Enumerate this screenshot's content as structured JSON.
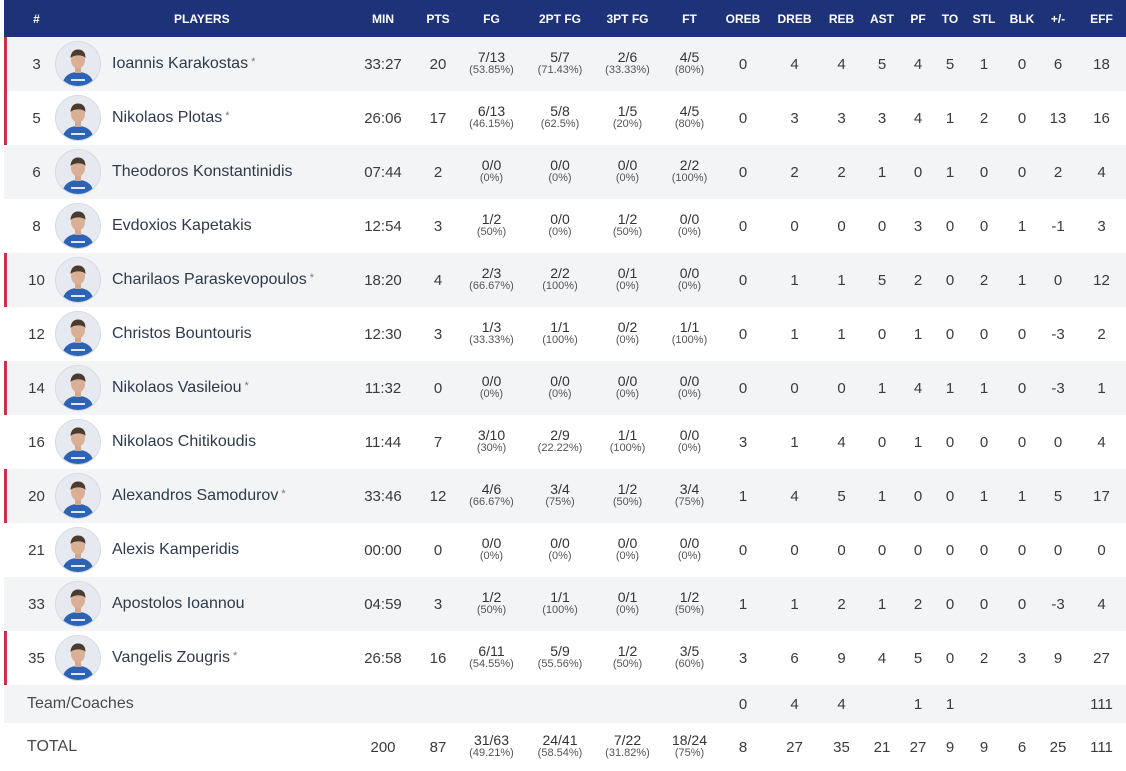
{
  "columns": [
    "#",
    "PLAYERS",
    "MIN",
    "PTS",
    "FG",
    "2PT FG",
    "3PT FG",
    "FT",
    "OREB",
    "DREB",
    "REB",
    "AST",
    "PF",
    "TO",
    "STL",
    "BLK",
    "+/-",
    "EFF"
  ],
  "starter_marker": "*",
  "players": [
    {
      "num": "3",
      "name": "Ioannis Karakostas",
      "starter": true,
      "min": "33:27",
      "pts": "20",
      "fg": {
        "made": "7/13",
        "pct": "(53.85%)"
      },
      "fg2": {
        "made": "5/7",
        "pct": "(71.43%)"
      },
      "fg3": {
        "made": "2/6",
        "pct": "(33.33%)"
      },
      "ft": {
        "made": "4/5",
        "pct": "(80%)"
      },
      "oreb": "0",
      "dreb": "4",
      "reb": "4",
      "ast": "5",
      "pf": "4",
      "to": "5",
      "stl": "1",
      "blk": "0",
      "pm": "6",
      "eff": "18",
      "avatar": "avatar-icon"
    },
    {
      "num": "5",
      "name": "Nikolaos Plotas",
      "starter": true,
      "min": "26:06",
      "pts": "17",
      "fg": {
        "made": "6/13",
        "pct": "(46.15%)"
      },
      "fg2": {
        "made": "5/8",
        "pct": "(62.5%)"
      },
      "fg3": {
        "made": "1/5",
        "pct": "(20%)"
      },
      "ft": {
        "made": "4/5",
        "pct": "(80%)"
      },
      "oreb": "0",
      "dreb": "3",
      "reb": "3",
      "ast": "3",
      "pf": "4",
      "to": "1",
      "stl": "2",
      "blk": "0",
      "pm": "13",
      "eff": "16",
      "avatar": "avatar-icon"
    },
    {
      "num": "6",
      "name": "Theodoros Konstantinidis",
      "starter": false,
      "min": "07:44",
      "pts": "2",
      "fg": {
        "made": "0/0",
        "pct": "(0%)"
      },
      "fg2": {
        "made": "0/0",
        "pct": "(0%)"
      },
      "fg3": {
        "made": "0/0",
        "pct": "(0%)"
      },
      "ft": {
        "made": "2/2",
        "pct": "(100%)"
      },
      "oreb": "0",
      "dreb": "2",
      "reb": "2",
      "ast": "1",
      "pf": "0",
      "to": "1",
      "stl": "0",
      "blk": "0",
      "pm": "2",
      "eff": "4",
      "avatar": "avatar-icon"
    },
    {
      "num": "8",
      "name": "Evdoxios Kapetakis",
      "starter": false,
      "min": "12:54",
      "pts": "3",
      "fg": {
        "made": "1/2",
        "pct": "(50%)"
      },
      "fg2": {
        "made": "0/0",
        "pct": "(0%)"
      },
      "fg3": {
        "made": "1/2",
        "pct": "(50%)"
      },
      "ft": {
        "made": "0/0",
        "pct": "(0%)"
      },
      "oreb": "0",
      "dreb": "0",
      "reb": "0",
      "ast": "0",
      "pf": "3",
      "to": "0",
      "stl": "0",
      "blk": "1",
      "pm": "-1",
      "eff": "3",
      "avatar": "avatar-icon"
    },
    {
      "num": "10",
      "name": "Charilaos Paraskevopoulos",
      "starter": true,
      "min": "18:20",
      "pts": "4",
      "fg": {
        "made": "2/3",
        "pct": "(66.67%)"
      },
      "fg2": {
        "made": "2/2",
        "pct": "(100%)"
      },
      "fg3": {
        "made": "0/1",
        "pct": "(0%)"
      },
      "ft": {
        "made": "0/0",
        "pct": "(0%)"
      },
      "oreb": "0",
      "dreb": "1",
      "reb": "1",
      "ast": "5",
      "pf": "2",
      "to": "0",
      "stl": "2",
      "blk": "1",
      "pm": "0",
      "eff": "12",
      "avatar": "avatar-icon"
    },
    {
      "num": "12",
      "name": "Christos Bountouris",
      "starter": false,
      "min": "12:30",
      "pts": "3",
      "fg": {
        "made": "1/3",
        "pct": "(33.33%)"
      },
      "fg2": {
        "made": "1/1",
        "pct": "(100%)"
      },
      "fg3": {
        "made": "0/2",
        "pct": "(0%)"
      },
      "ft": {
        "made": "1/1",
        "pct": "(100%)"
      },
      "oreb": "0",
      "dreb": "1",
      "reb": "1",
      "ast": "0",
      "pf": "1",
      "to": "0",
      "stl": "0",
      "blk": "0",
      "pm": "-3",
      "eff": "2",
      "avatar": "avatar-icon"
    },
    {
      "num": "14",
      "name": "Nikolaos Vasileiou",
      "starter": true,
      "min": "11:32",
      "pts": "0",
      "fg": {
        "made": "0/0",
        "pct": "(0%)"
      },
      "fg2": {
        "made": "0/0",
        "pct": "(0%)"
      },
      "fg3": {
        "made": "0/0",
        "pct": "(0%)"
      },
      "ft": {
        "made": "0/0",
        "pct": "(0%)"
      },
      "oreb": "0",
      "dreb": "0",
      "reb": "0",
      "ast": "1",
      "pf": "4",
      "to": "1",
      "stl": "1",
      "blk": "0",
      "pm": "-3",
      "eff": "1",
      "avatar": "avatar-icon"
    },
    {
      "num": "16",
      "name": "Nikolaos Chitikoudis",
      "starter": false,
      "min": "11:44",
      "pts": "7",
      "fg": {
        "made": "3/10",
        "pct": "(30%)"
      },
      "fg2": {
        "made": "2/9",
        "pct": "(22.22%)"
      },
      "fg3": {
        "made": "1/1",
        "pct": "(100%)"
      },
      "ft": {
        "made": "0/0",
        "pct": "(0%)"
      },
      "oreb": "3",
      "dreb": "1",
      "reb": "4",
      "ast": "0",
      "pf": "1",
      "to": "0",
      "stl": "0",
      "blk": "0",
      "pm": "0",
      "eff": "4",
      "avatar": "avatar-icon"
    },
    {
      "num": "20",
      "name": "Alexandros Samodurov",
      "starter": true,
      "min": "33:46",
      "pts": "12",
      "fg": {
        "made": "4/6",
        "pct": "(66.67%)"
      },
      "fg2": {
        "made": "3/4",
        "pct": "(75%)"
      },
      "fg3": {
        "made": "1/2",
        "pct": "(50%)"
      },
      "ft": {
        "made": "3/4",
        "pct": "(75%)"
      },
      "oreb": "1",
      "dreb": "4",
      "reb": "5",
      "ast": "1",
      "pf": "0",
      "to": "0",
      "stl": "1",
      "blk": "1",
      "pm": "5",
      "eff": "17",
      "avatar": "avatar-icon"
    },
    {
      "num": "21",
      "name": "Alexis Kamperidis",
      "starter": false,
      "min": "00:00",
      "pts": "0",
      "fg": {
        "made": "0/0",
        "pct": "(0%)"
      },
      "fg2": {
        "made": "0/0",
        "pct": "(0%)"
      },
      "fg3": {
        "made": "0/0",
        "pct": "(0%)"
      },
      "ft": {
        "made": "0/0",
        "pct": "(0%)"
      },
      "oreb": "0",
      "dreb": "0",
      "reb": "0",
      "ast": "0",
      "pf": "0",
      "to": "0",
      "stl": "0",
      "blk": "0",
      "pm": "0",
      "eff": "0",
      "avatar": "avatar-icon"
    },
    {
      "num": "33",
      "name": "Apostolos Ioannou",
      "starter": false,
      "min": "04:59",
      "pts": "3",
      "fg": {
        "made": "1/2",
        "pct": "(50%)"
      },
      "fg2": {
        "made": "1/1",
        "pct": "(100%)"
      },
      "fg3": {
        "made": "0/1",
        "pct": "(0%)"
      },
      "ft": {
        "made": "1/2",
        "pct": "(50%)"
      },
      "oreb": "1",
      "dreb": "1",
      "reb": "2",
      "ast": "1",
      "pf": "2",
      "to": "0",
      "stl": "0",
      "blk": "0",
      "pm": "-3",
      "eff": "4",
      "avatar": "avatar-icon"
    },
    {
      "num": "35",
      "name": "Vangelis Zougris",
      "starter": true,
      "min": "26:58",
      "pts": "16",
      "fg": {
        "made": "6/11",
        "pct": "(54.55%)"
      },
      "fg2": {
        "made": "5/9",
        "pct": "(55.56%)"
      },
      "fg3": {
        "made": "1/2",
        "pct": "(50%)"
      },
      "ft": {
        "made": "3/5",
        "pct": "(60%)"
      },
      "oreb": "3",
      "dreb": "6",
      "reb": "9",
      "ast": "4",
      "pf": "5",
      "to": "0",
      "stl": "2",
      "blk": "3",
      "pm": "9",
      "eff": "27",
      "avatar": "avatar-icon"
    }
  ],
  "team": {
    "label": "Team/Coaches",
    "oreb": "0",
    "dreb": "4",
    "reb": "4",
    "pf": "1",
    "to": "1",
    "eff": "111"
  },
  "total": {
    "label": "TOTAL",
    "min": "200",
    "pts": "87",
    "fg": {
      "made": "31/63",
      "pct": "(49.21%)"
    },
    "fg2": {
      "made": "24/41",
      "pct": "(58.54%)"
    },
    "fg3": {
      "made": "7/22",
      "pct": "(31.82%)"
    },
    "ft": {
      "made": "18/24",
      "pct": "(75%)"
    },
    "oreb": "8",
    "dreb": "27",
    "reb": "35",
    "ast": "21",
    "pf": "27",
    "to": "9",
    "stl": "9",
    "blk": "6",
    "pm": "25",
    "eff": "111"
  },
  "colors": {
    "header_bg": "#1d3278",
    "starter_accent": "#c8334c",
    "row_alt": "#f3f4f6",
    "jersey": "#2c63b5"
  }
}
